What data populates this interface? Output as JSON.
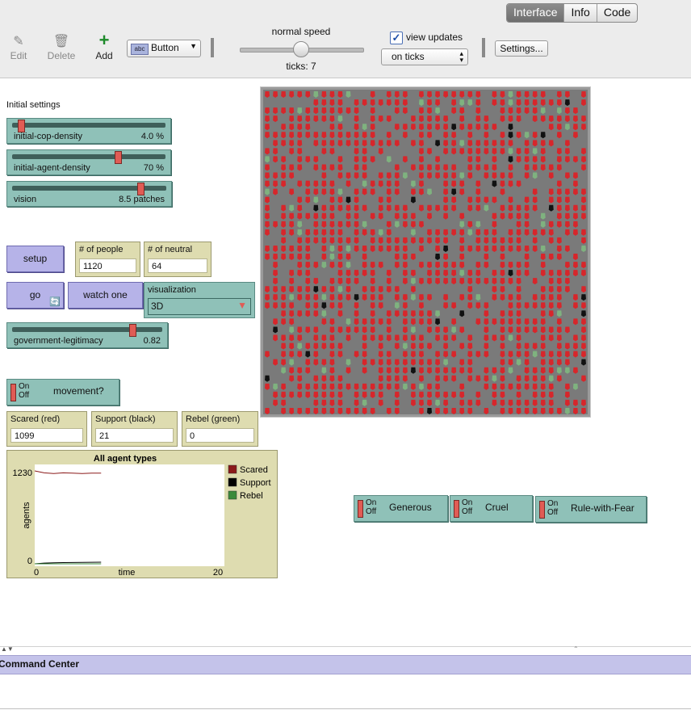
{
  "toolbar": {
    "tabs": [
      {
        "label": "Interface",
        "active": true
      },
      {
        "label": "Info",
        "active": false
      },
      {
        "label": "Code",
        "active": false
      }
    ],
    "edit_label": "Edit",
    "delete_label": "Delete",
    "add_label": "Add",
    "widget_type": "Button",
    "widget_icon_text": "abc",
    "speed_label": "normal speed",
    "ticks_label": "ticks: 7",
    "view_updates_label": "view updates",
    "view_updates_checked": true,
    "update_mode": "on ticks",
    "settings_label": "Settings..."
  },
  "initial_settings_title": "Initial settings",
  "sliders": [
    {
      "name": "initial-cop-density",
      "value": "4.0 %",
      "fraction": 0.04
    },
    {
      "name": "initial-agent-density",
      "value": "70 %",
      "fraction": 0.7
    },
    {
      "name": "vision",
      "value": "8.5 patches",
      "fraction": 0.85
    }
  ],
  "buttons": {
    "setup": "setup",
    "go": "go",
    "watch_one": "watch one"
  },
  "monitors": {
    "people": {
      "label": "# of people",
      "value": "1120"
    },
    "neutral": {
      "label": "# of neutral",
      "value": "64"
    },
    "scared": {
      "label": "Scared (red)",
      "value": "1099"
    },
    "support": {
      "label": "Support (black)",
      "value": "21"
    },
    "rebel": {
      "label": "Rebel (green)",
      "value": "0"
    }
  },
  "chooser": {
    "label": "visualization",
    "value": "3D"
  },
  "legitimacy_slider": {
    "name": "government-legitimacy",
    "value": "0.82",
    "fraction": 0.82
  },
  "switches": {
    "on": "On",
    "off": "Off",
    "movement": "movement?",
    "generous": "Generous",
    "cruel": "Cruel",
    "rule_with_fear": "Rule-with-Fear"
  },
  "plot": {
    "title": "All agent types",
    "ylabel": "agents",
    "xlabel": "time",
    "ymax_label": "1230",
    "ymin_label": "0",
    "xmin_label": "0",
    "xmax_label": "20",
    "legend": [
      {
        "name": "Scared",
        "color": "#8b1a1a"
      },
      {
        "name": "Support",
        "color": "#000000"
      },
      {
        "name": "Rebel",
        "color": "#3b8a3b"
      }
    ]
  },
  "chart_data": {
    "type": "line",
    "title": "All agent types",
    "xlabel": "time",
    "ylabel": "agents",
    "xlim": [
      0,
      20
    ],
    "ylim": [
      0,
      1230
    ],
    "x": [
      0,
      1,
      2,
      3,
      4,
      5,
      6,
      7
    ],
    "series": [
      {
        "name": "Scared",
        "color": "#8b1a1a",
        "values": [
          1230,
          1205,
          1195,
          1205,
          1200,
          1195,
          1200,
          1200
        ]
      },
      {
        "name": "Support",
        "color": "#000000",
        "values": [
          0,
          10,
          14,
          16,
          18,
          19,
          20,
          21
        ]
      },
      {
        "name": "Rebel",
        "color": "#3b8a3b",
        "values": [
          0,
          0,
          0,
          0,
          0,
          0,
          0,
          0
        ]
      }
    ]
  },
  "command_center": {
    "title": "Command Center"
  },
  "colors": {
    "world_bg": "#7a7a7a",
    "scared_agent": "#d7262b",
    "support_agent": "#111111",
    "neutral_agent": "#7fb27f",
    "slider_bg": "#8fc1b8",
    "button_bg": "#b6b3e8",
    "monitor_bg": "#dedcb0"
  }
}
